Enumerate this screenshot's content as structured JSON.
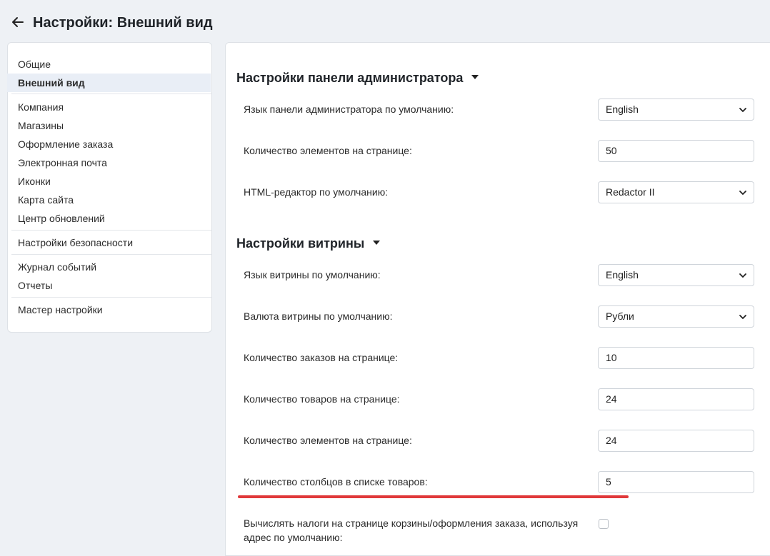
{
  "header": {
    "title": "Настройки: Внешний вид",
    "back_icon": "arrow-left-icon"
  },
  "sidebar": {
    "items": [
      {
        "label": "Общие"
      },
      {
        "label": "Внешний вид",
        "active": true
      },
      {
        "label": "Компания"
      },
      {
        "label": "Магазины"
      },
      {
        "label": "Оформление заказа"
      },
      {
        "label": "Электронная почта"
      },
      {
        "label": "Иконки"
      },
      {
        "label": "Карта сайта"
      },
      {
        "label": "Центр обновлений"
      },
      {
        "label": "Настройки безопасности"
      },
      {
        "label": "Журнал событий"
      },
      {
        "label": "Отчеты"
      },
      {
        "label": "Мастер настройки"
      }
    ]
  },
  "admin_section": {
    "title": "Настройки панели администратора",
    "rows": [
      {
        "label": "Язык панели администратора по умолчанию:",
        "value": "English"
      },
      {
        "label": "Количество элементов на странице:",
        "value": "50"
      },
      {
        "label": "HTML-редактор по умолчанию:",
        "value": "Redactor II"
      }
    ]
  },
  "storefront_section": {
    "title": "Настройки витрины",
    "rows": [
      {
        "label": "Язык витрины по умолчанию:",
        "value": "English"
      },
      {
        "label": "Валюта витрины по умолчанию:",
        "value": "Рубли"
      },
      {
        "label": "Количество заказов на странице:",
        "value": "10"
      },
      {
        "label": "Количество товаров на странице:",
        "value": "24"
      },
      {
        "label": "Количество элементов на странице:",
        "value": "24"
      },
      {
        "label": "Количество столбцов в списке товаров:",
        "value": "5"
      },
      {
        "label_line1": "Вычислять налоги на странице корзины/оформления заказа, используя",
        "label_line2": "адрес по умолчанию:",
        "checked": false
      }
    ]
  },
  "colors": {
    "background": "#eef1f5",
    "panel": "#ffffff",
    "active_item": "#e9eef6",
    "highlight_underline": "#e0383a"
  }
}
